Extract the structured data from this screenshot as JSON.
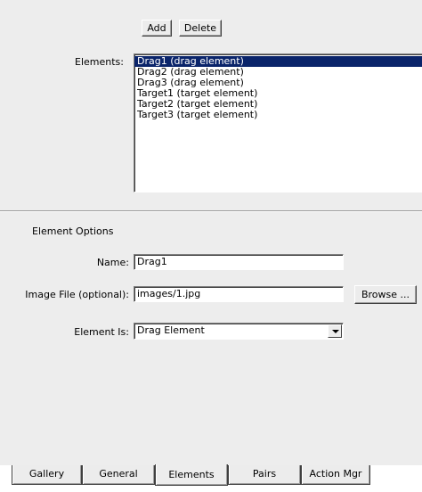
{
  "toolbar": {
    "add_label": "Add",
    "delete_label": "Delete"
  },
  "elements": {
    "label": "Elements:",
    "items": [
      "Drag1 (drag element)",
      "Drag2 (drag element)",
      "Drag3 (drag element)",
      "Target1 (target element)",
      "Target2 (target element)",
      "Target3 (target element)"
    ],
    "selected_index": 0
  },
  "options": {
    "section_title": "Element Options",
    "name_label": "Name:",
    "name_value": "Drag1",
    "image_label": "Image File (optional):",
    "image_value": "images/1.jpg",
    "browse_label": "Browse ...",
    "element_is_label": "Element Is:",
    "element_is_value": "Drag Element"
  },
  "tabs": [
    {
      "label": "Gallery",
      "active": false
    },
    {
      "label": "General",
      "active": false
    },
    {
      "label": "Elements",
      "active": true
    },
    {
      "label": "Pairs",
      "active": false
    },
    {
      "label": "Action Mgr",
      "active": false
    }
  ]
}
